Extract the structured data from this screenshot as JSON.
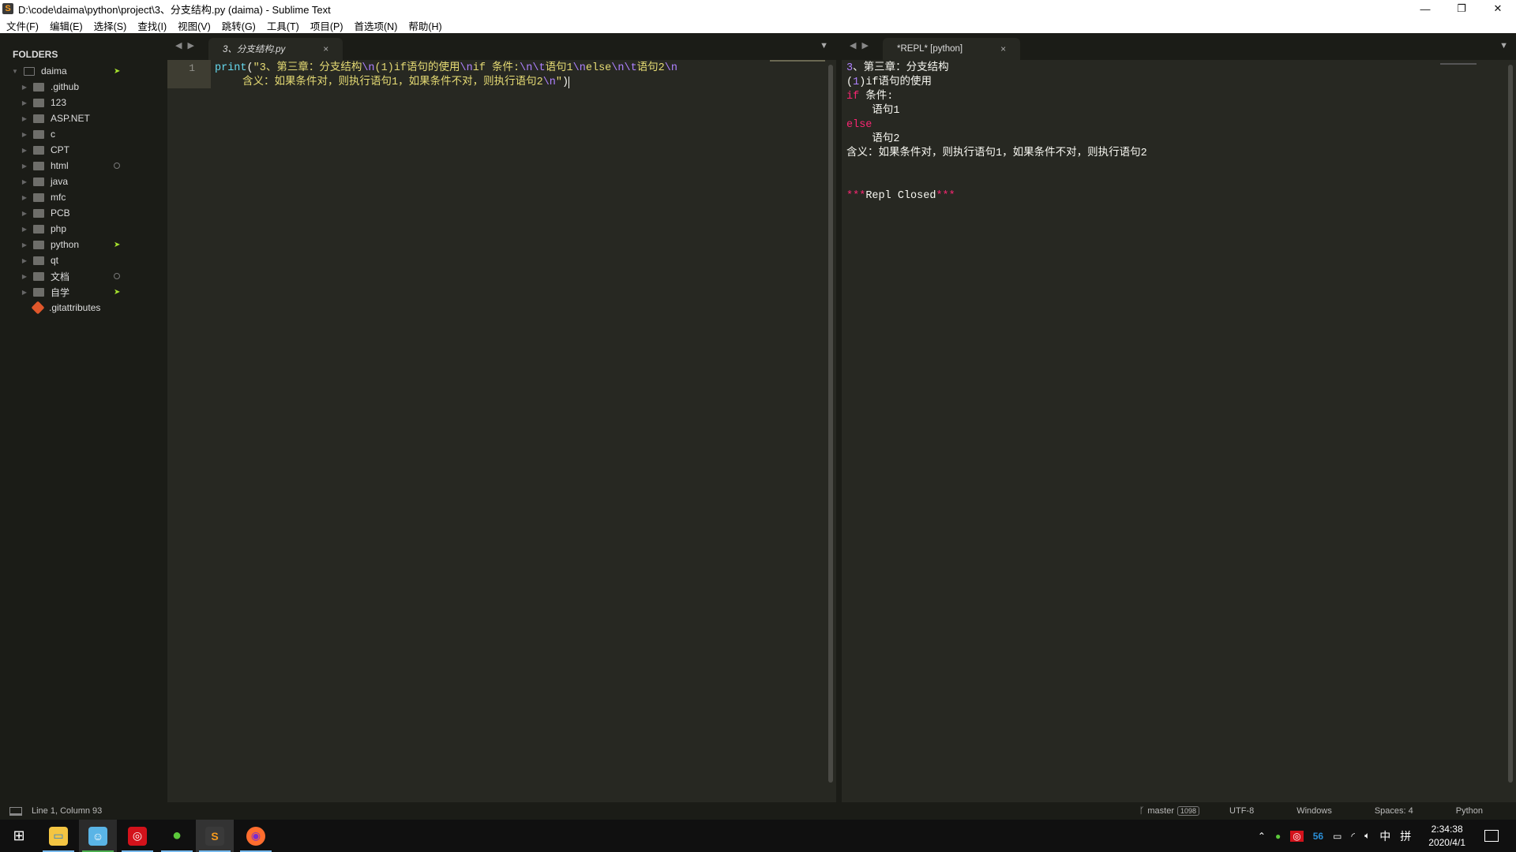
{
  "window": {
    "title": "D:\\code\\daima\\python\\project\\3、分支结构.py (daima) - Sublime Text",
    "controls": {
      "minimize": "—",
      "restore": "❐",
      "close": "✕"
    }
  },
  "menu": [
    "文件(F)",
    "编辑(E)",
    "选择(S)",
    "查找(I)",
    "视图(V)",
    "跳转(G)",
    "工具(T)",
    "项目(P)",
    "首选项(N)",
    "帮助(H)"
  ],
  "sidebar": {
    "header": "FOLDERS",
    "root": {
      "label": "daima",
      "status": "modified"
    },
    "items": [
      {
        "label": ".github",
        "status": ""
      },
      {
        "label": "123",
        "status": ""
      },
      {
        "label": "ASP.NET",
        "status": ""
      },
      {
        "label": "c",
        "status": ""
      },
      {
        "label": "CPT",
        "status": ""
      },
      {
        "label": "html",
        "status": "untracked"
      },
      {
        "label": "java",
        "status": ""
      },
      {
        "label": "mfc",
        "status": ""
      },
      {
        "label": "PCB",
        "status": ""
      },
      {
        "label": "php",
        "status": ""
      },
      {
        "label": "python",
        "status": "modified"
      },
      {
        "label": "qt",
        "status": ""
      },
      {
        "label": "文档",
        "status": "untracked"
      },
      {
        "label": "自学",
        "status": "modified"
      }
    ],
    "files": [
      {
        "label": ".gitattributes",
        "icon": "git-icon"
      }
    ]
  },
  "editor": {
    "tab": {
      "label": "3、分支结构.py",
      "close": "×"
    },
    "line_number": "1",
    "code": {
      "fn": "print",
      "open": "(",
      "segments": [
        {
          "t": "str",
          "v": "\"3、第三章：分支结构"
        },
        {
          "t": "esc",
          "v": "\\n"
        },
        {
          "t": "str",
          "v": "(1)if语句的使用"
        },
        {
          "t": "esc",
          "v": "\\n"
        },
        {
          "t": "str",
          "v": "if 条件:"
        },
        {
          "t": "esc",
          "v": "\\n\\t"
        },
        {
          "t": "str",
          "v": "语句1"
        },
        {
          "t": "esc",
          "v": "\\n"
        },
        {
          "t": "str",
          "v": "else"
        },
        {
          "t": "esc",
          "v": "\\n\\t"
        },
        {
          "t": "str",
          "v": "语句2"
        },
        {
          "t": "esc",
          "v": "\\n"
        }
      ],
      "wrap_segments": [
        {
          "t": "str",
          "v": "含义：如果条件对，则执行语句1，如果条件不对，则执行语句2"
        },
        {
          "t": "esc",
          "v": "\\n"
        },
        {
          "t": "str",
          "v": "\""
        }
      ],
      "close": ")"
    }
  },
  "repl": {
    "tab": {
      "label": "*REPL* [python]",
      "close": "×"
    },
    "output": {
      "line1_num": "3",
      "line1_rest": "、第三章：分支结构",
      "line2_open": "(",
      "line2_num": "1",
      "line2_rest": ")if语句的使用",
      "line3_kw": "if",
      "line3_rest": " 条件:",
      "line4": "    语句1",
      "line5_kw": "else",
      "line6": "    语句2",
      "line7": "含义：如果条件对，则执行语句1，如果条件不对，则执行语句2",
      "closed_stars_l": "***",
      "closed_text": "Repl Closed",
      "closed_stars_r": "***"
    }
  },
  "statusbar": {
    "position": "Line 1, Column 93",
    "branch": "master",
    "branch_count": "1098",
    "encoding": "UTF-8",
    "line_endings": "Windows",
    "indent": "Spaces: 4",
    "syntax": "Python"
  },
  "taskbar": {
    "apps": [
      {
        "name": "file-explorer",
        "active": false
      },
      {
        "name": "app-blue",
        "active": false
      },
      {
        "name": "netease-music",
        "active": false
      },
      {
        "name": "wechat",
        "active": false
      },
      {
        "name": "sublime-text",
        "active": true
      },
      {
        "name": "firefox",
        "active": false
      }
    ],
    "tray": {
      "sogou": "56",
      "ime_lang": "中",
      "ime_mode": "拼"
    },
    "clock": {
      "time": "2:34:38",
      "date": "2020/4/1"
    }
  },
  "colors": {
    "accent_keyword": "#f92672",
    "string": "#e6db74",
    "escape": "#ae81ff",
    "function": "#66d9ef",
    "git_modified": "#a6e22e"
  }
}
